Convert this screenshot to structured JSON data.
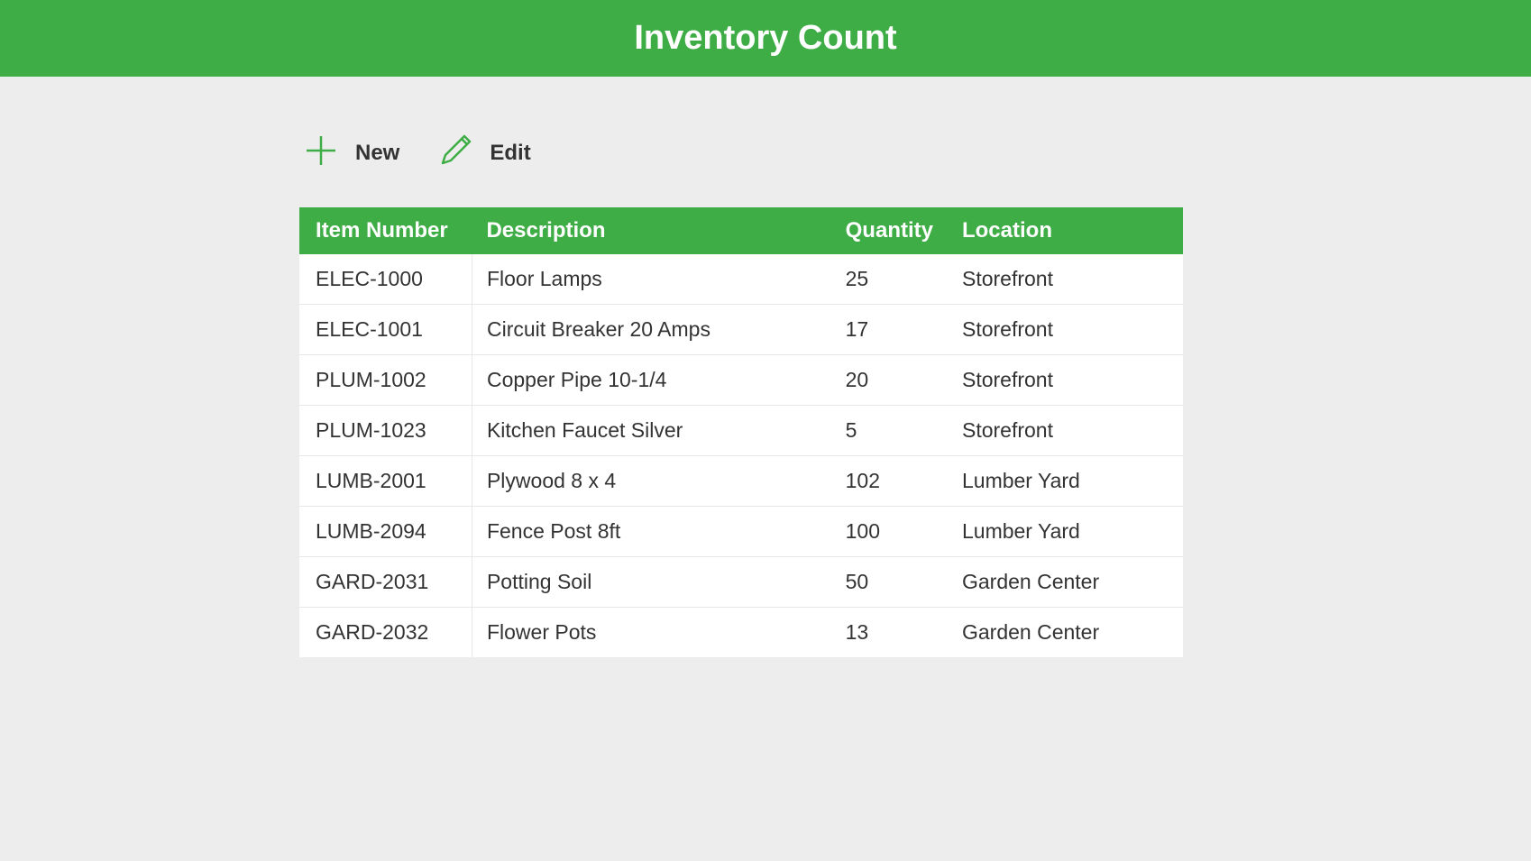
{
  "header": {
    "title": "Inventory Count"
  },
  "toolbar": {
    "new_label": "New",
    "edit_label": "Edit"
  },
  "colors": {
    "accent": "#3fad46"
  },
  "table": {
    "headers": {
      "item_number": "Item Number",
      "description": "Description",
      "quantity": "Quantity",
      "location": "Location"
    },
    "rows": [
      {
        "item_number": "ELEC-1000",
        "description": "Floor Lamps",
        "quantity": "25",
        "location": "Storefront"
      },
      {
        "item_number": "ELEC-1001",
        "description": "Circuit Breaker 20 Amps",
        "quantity": "17",
        "location": "Storefront"
      },
      {
        "item_number": "PLUM-1002",
        "description": "Copper Pipe 10-1/4",
        "quantity": "20",
        "location": "Storefront"
      },
      {
        "item_number": "PLUM-1023",
        "description": "Kitchen Faucet Silver",
        "quantity": "5",
        "location": "Storefront"
      },
      {
        "item_number": "LUMB-2001",
        "description": "Plywood 8 x 4",
        "quantity": "102",
        "location": "Lumber Yard"
      },
      {
        "item_number": "LUMB-2094",
        "description": "Fence Post 8ft",
        "quantity": "100",
        "location": "Lumber Yard"
      },
      {
        "item_number": "GARD-2031",
        "description": "Potting Soil",
        "quantity": "50",
        "location": "Garden Center"
      },
      {
        "item_number": "GARD-2032",
        "description": "Flower Pots",
        "quantity": "13",
        "location": "Garden Center"
      }
    ]
  }
}
